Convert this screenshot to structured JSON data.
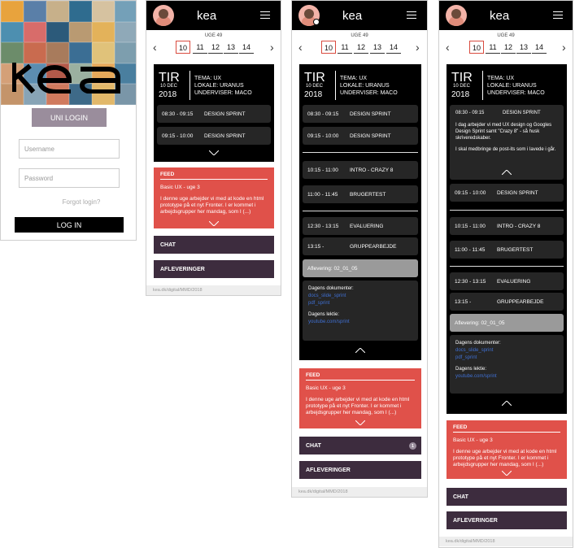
{
  "login": {
    "uni_login": "UNI LOGIN",
    "username_placeholder": "Username",
    "password_placeholder": "Password",
    "forgot": "Forgot login?",
    "login_button": "LOG IN",
    "photo_colors": [
      "#e8a33d",
      "#5a7fa8",
      "#c7b08a",
      "#2f6c8f",
      "#d6c2a0",
      "#74a0b8",
      "#4d8fb0",
      "#d86c6a",
      "#2c5a7a",
      "#b99a72",
      "#e3b25a",
      "#8fa9b8",
      "#6c8c6a",
      "#c96b4f",
      "#a87b5c",
      "#3b6e94",
      "#e0c27a",
      "#7d9eae",
      "#d4a078",
      "#5c8db0",
      "#b35a4a",
      "#9bb0a0",
      "#e5a85a",
      "#4a7f9f",
      "#c4946a",
      "#88a4b6",
      "#d07a5e",
      "#3e6a88",
      "#e2b86a",
      "#7a96a8"
    ]
  },
  "logo_text": "kea",
  "week_label": "UGE 49",
  "days": [
    "10",
    "11",
    "12",
    "13",
    "14"
  ],
  "schedule": {
    "day": "TIR",
    "date": "10 DEC",
    "year": "2018",
    "tema": "TEMA: UX",
    "lokale": "LOKALE: URANUS",
    "underviser": "UNDERVISER: MACO"
  },
  "slots": {
    "s1_time": "08:30 - 09:15",
    "s1_title": "DESIGN SPRINT",
    "s2_time": "09:15 - 10:00",
    "s2_title": "DESIGN SPRINT",
    "s3_time": "10:15 - 11:00",
    "s3_title": "INTRO - CRAZY 8",
    "s4_time": "11:00 - 11:45",
    "s4_title": "BRUGERTEST",
    "s5_time": "12:30 - 13:15",
    "s5_title": "EVALUERING",
    "s6_time": "13:15 -",
    "s6_title": "GRUPPEARBEJDE",
    "aflevering": "Aflevering: 02_01_05"
  },
  "docs": {
    "dagens_dokumenter": "Dagens dokumenter:",
    "link1": "docs_slide_sprint",
    "link2": "pdf_sprint",
    "dagens_lektie": "Dagens lektie:",
    "link3": "youtube.com/sprint"
  },
  "expanded": {
    "text1": "I dag arbejder vi med UX design og Googles Design Sprint samt \"Crazy 8\" - så husk skriveredskaber.",
    "text2": "I skal medbringe de post-its som i lavede i går."
  },
  "feed": {
    "title": "FEED",
    "subtitle": "Basic UX - uge 3",
    "body": "I denne uge arbejder vi med at kode en html prototype på et nyt Fronter. I er kommet i arbejdsgrupper her mandag, som I (...)"
  },
  "chat": "CHAT",
  "chat_count": "1",
  "afleveringer": "AFLEVERINGER",
  "footer_url": "kea.dk/digital/MMD/2018"
}
